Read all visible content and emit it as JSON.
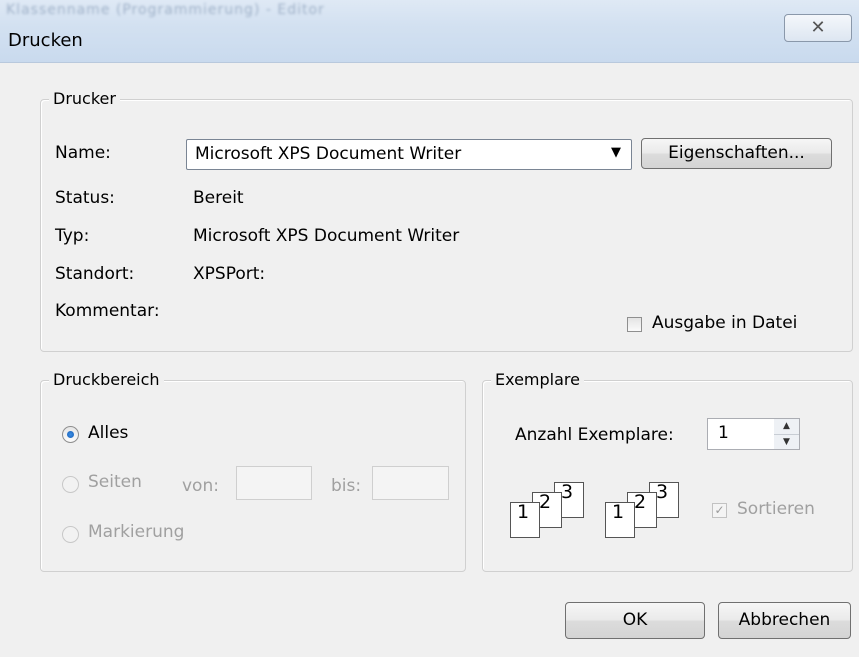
{
  "window": {
    "background_title": "Klassenname (Programmierung) - Editor",
    "title": "Drucken",
    "close_glyph": "✕"
  },
  "printer": {
    "legend": "Drucker",
    "name_label": "Name:",
    "name_value": "Microsoft XPS Document Writer",
    "properties_button": "Eigenschaften...",
    "status_label": "Status:",
    "status_value": "Bereit",
    "type_label": "Typ:",
    "type_value": "Microsoft XPS Document Writer",
    "location_label": "Standort:",
    "location_value": "XPSPort:",
    "comment_label": "Kommentar:",
    "print_to_file_label": "Ausgabe in Datei",
    "print_to_file_checked": false
  },
  "range": {
    "legend": "Druckbereich",
    "all_label": "Alles",
    "pages_label": "Seiten",
    "from_label": "von:",
    "to_label": "bis:",
    "from_value": "",
    "to_value": "",
    "selection_label": "Markierung",
    "selected": "all"
  },
  "copies": {
    "legend": "Exemplare",
    "count_label": "Anzahl Exemplare:",
    "count_value": "1",
    "collate_label": "Sortieren",
    "collate_checked": true,
    "collate_enabled": false,
    "page_numbers": [
      "1",
      "2",
      "3"
    ]
  },
  "footer": {
    "ok_button": "OK",
    "cancel_button": "Abbrechen"
  },
  "icons": {
    "close": "close-icon",
    "dropdown": "chevron-down-icon",
    "spin_up": "spin-up-icon",
    "spin_down": "spin-down-icon"
  }
}
